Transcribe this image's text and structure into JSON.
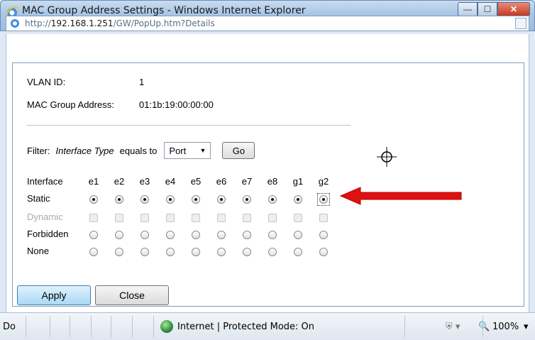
{
  "window": {
    "title": "MAC Group Address Settings - Windows Internet Explorer",
    "minimize": "—",
    "maximize": "☐",
    "close": "✕"
  },
  "address": {
    "prefix": "http://",
    "host": "192.168.1.251",
    "path": "/GW/PopUp.htm?Details"
  },
  "info": {
    "vlan_label": "VLAN ID:",
    "vlan_value": "1",
    "mac_label": "MAC Group Address:",
    "mac_value": "01:1b:19:00:00:00"
  },
  "filter": {
    "label": "Filter:",
    "field": "Interface Type",
    "op": "equals to",
    "selected": "Port",
    "go": "Go"
  },
  "grid": {
    "header_label": "Interface",
    "interfaces": [
      "e1",
      "e2",
      "e3",
      "e4",
      "e5",
      "e6",
      "e7",
      "e8",
      "g1",
      "g2"
    ],
    "rows": [
      {
        "label": "Static",
        "state": "checked"
      },
      {
        "label": "Dynamic",
        "state": "disabled"
      },
      {
        "label": "Forbidden",
        "state": "unchecked"
      },
      {
        "label": "None",
        "state": "unchecked"
      }
    ]
  },
  "buttons": {
    "apply": "Apply",
    "close": "Close"
  },
  "status": {
    "left": "Do",
    "zone": "Internet | Protected Mode: On",
    "zoom": "100%"
  },
  "colors": {
    "annotation_arrow": "#e01010"
  }
}
